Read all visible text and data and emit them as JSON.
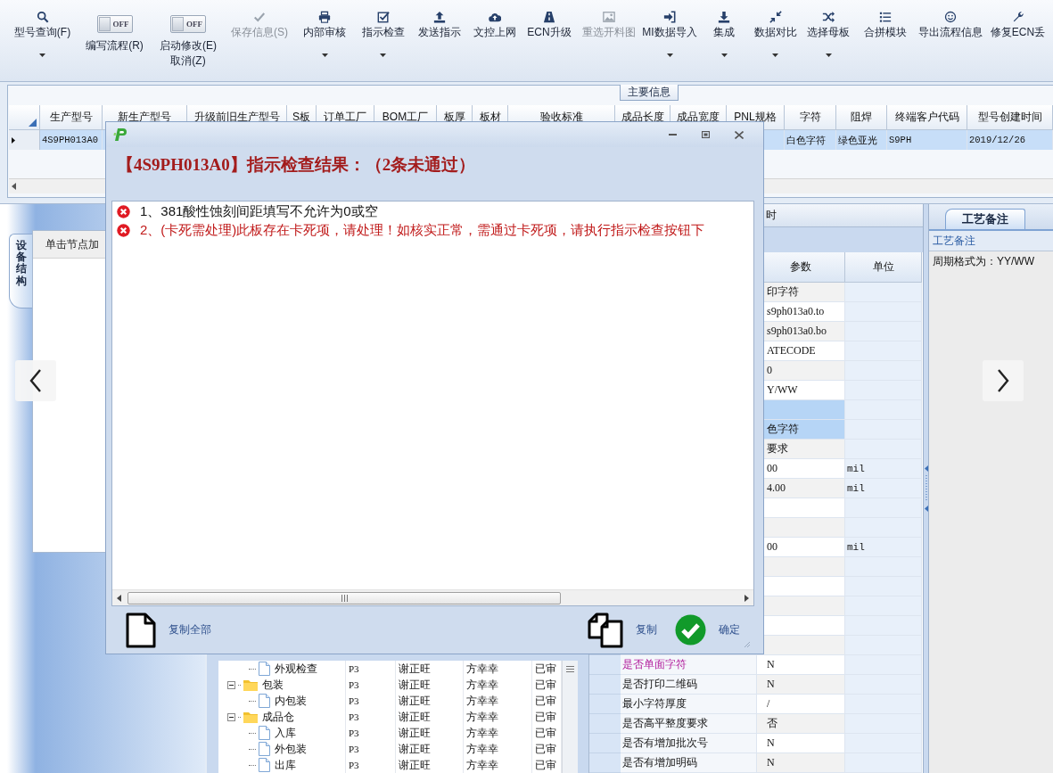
{
  "toolbar": {
    "items": [
      {
        "kind": "button",
        "label": "型号查询(F)",
        "dropdown": true,
        "disabled": false
      },
      {
        "kind": "toggle",
        "label": "编写流程(R)",
        "state": "OFF",
        "on": false
      },
      {
        "kind": "toggle",
        "label": "启动修改(E)",
        "label2": "取消(Z)",
        "state": "OFF",
        "on": false
      },
      {
        "kind": "button",
        "label": "保存信息(S)",
        "dropdown": false,
        "disabled": true
      },
      {
        "kind": "button",
        "label": "内部审核",
        "dropdown": true,
        "disabled": false
      },
      {
        "kind": "button",
        "label": "指示检查",
        "dropdown": true,
        "disabled": false
      },
      {
        "kind": "button",
        "label": "发送指示",
        "dropdown": false,
        "disabled": false
      },
      {
        "kind": "button",
        "label": "文控上网",
        "dropdown": false,
        "disabled": false
      },
      {
        "kind": "button",
        "label": "ECN升级",
        "dropdown": false,
        "disabled": false
      },
      {
        "kind": "button",
        "label": "重选开料图",
        "dropdown": false,
        "disabled": true
      },
      {
        "kind": "button",
        "label": "MI数据导入",
        "dropdown": true,
        "disabled": false
      },
      {
        "kind": "button",
        "label": "集成",
        "dropdown": true,
        "disabled": false
      },
      {
        "kind": "button",
        "label": "数据对比",
        "dropdown": true,
        "disabled": false
      },
      {
        "kind": "button",
        "label": "选择母板",
        "dropdown": true,
        "disabled": false
      },
      {
        "kind": "button",
        "label": "合拼模块",
        "dropdown": false,
        "disabled": false
      },
      {
        "kind": "button",
        "label": "导出流程信息",
        "dropdown": false,
        "disabled": false
      },
      {
        "kind": "button",
        "label": "修复ECN丢",
        "dropdown": false,
        "disabled": false
      }
    ]
  },
  "main_info": {
    "legend": "主要信息",
    "row_selected": true,
    "columns": [
      {
        "label": "生产型号",
        "cell": "4S9PH013A0"
      },
      {
        "label": "新生产型号"
      },
      {
        "label": "升级前旧生产型号"
      },
      {
        "label": "S板"
      },
      {
        "label": "订单工厂"
      },
      {
        "label": "BOM工厂"
      },
      {
        "label": "板厚"
      },
      {
        "label": "板材"
      },
      {
        "label": "验收标准"
      },
      {
        "label": "成品长度"
      },
      {
        "label": "成品宽度"
      },
      {
        "label": "PNL规格"
      },
      {
        "label": "字符",
        "cell": "白色字符"
      },
      {
        "label": "阻焊",
        "cell": "绿色亚光"
      },
      {
        "label": "终端客户代码",
        "cell": "S9PH"
      },
      {
        "label": "型号创建时间",
        "cell": "2019/12/26"
      }
    ]
  },
  "lower": {
    "caption_tail": "时",
    "side_tab": "设备结构",
    "side_header": "单击节点加",
    "tree": {
      "items": [
        {
          "kind": "leaf",
          "label": "外观检查",
          "cells": [
            "P3",
            "谢正旺",
            "方幸幸",
            "已审"
          ]
        },
        {
          "kind": "folder",
          "label": "包装",
          "expanded": true,
          "cells": [
            "P3",
            "谢正旺",
            "方幸幸",
            "已审"
          ],
          "children": [
            {
              "kind": "leaf",
              "label": "内包装",
              "cells": [
                "P3",
                "谢正旺",
                "方幸幸",
                "已审"
              ]
            }
          ]
        },
        {
          "kind": "folder",
          "label": "成品仓",
          "expanded": true,
          "cells": [
            "P3",
            "谢正旺",
            "方幸幸",
            "已审"
          ],
          "children": [
            {
              "kind": "leaf",
              "label": "入库",
              "cells": [
                "P3",
                "谢正旺",
                "方幸幸",
                "已审"
              ]
            },
            {
              "kind": "leaf",
              "label": "外包装",
              "cells": [
                "P3",
                "谢正旺",
                "方幸幸",
                "已审"
              ]
            },
            {
              "kind": "leaf",
              "label": "出库",
              "cells": [
                "P3",
                "谢正旺",
                "方幸幸",
                "已审"
              ]
            }
          ]
        }
      ]
    },
    "params": {
      "columns": [
        "参数",
        "单位"
      ],
      "rows": [
        {
          "value": "印字符",
          "selected": false
        },
        {
          "value": "s9ph013a0.to",
          "selected": false
        },
        {
          "value": "s9ph013a0.bo",
          "selected": false
        },
        {
          "value": "ATECODE",
          "selected": false
        },
        {
          "value": "0",
          "selected": false
        },
        {
          "value": "Y/WW",
          "selected": false
        },
        {
          "selected": true
        },
        {
          "value": "色字符",
          "selected": true
        },
        {
          "value": "要求",
          "selected": false
        },
        {
          "value": "00",
          "unit": "mil",
          "selected": false
        },
        {
          "value": "4.00",
          "unit": "mil",
          "selected": false
        },
        {
          "selected": false
        },
        {
          "selected": false
        },
        {
          "value": "00",
          "unit": "mil",
          "selected": false
        },
        {
          "selected": false
        },
        {
          "selected": false
        },
        {
          "selected": false
        },
        {
          "selected": false
        },
        {
          "selected": false
        },
        {
          "name": "是否单面字符",
          "kind": "flagged",
          "value": "N",
          "selected": false
        },
        {
          "name": "是否打印二维码",
          "kind": "normal",
          "value": "N",
          "selected": false
        },
        {
          "name": "最小字符厚度",
          "kind": "normal",
          "value": "/",
          "selected": false
        },
        {
          "name": "是否高平整度要求",
          "kind": "normal",
          "value": "否",
          "selected": false
        },
        {
          "name": "是否有增加批次号",
          "kind": "normal",
          "value": "N",
          "selected": false
        },
        {
          "name": "是否有增加明码",
          "kind": "normal",
          "value": "N",
          "selected": false
        }
      ]
    },
    "notes": {
      "tabs": [
        {
          "label": "工艺备注",
          "selected": true
        }
      ],
      "header": "工艺备注",
      "text": "周期格式为：YY/WW"
    }
  },
  "dialog": {
    "heading": "【4S9PH013A0】指示检查结果：（2条未通过）",
    "messages": [
      {
        "kind": "error",
        "text": "1、381酸性蚀刻间距填写不允许为0或空"
      },
      {
        "kind": "blocking",
        "text": "2、(卡死需处理)此板存在卡死项，请处理！如核实正常，需通过卡死项，请执行指示检查按钮下"
      }
    ],
    "actions": [
      {
        "kind": "copy-all",
        "label": "复制全部"
      },
      {
        "kind": "copy",
        "label": "复制"
      },
      {
        "kind": "confirm",
        "label": "确定"
      }
    ]
  }
}
